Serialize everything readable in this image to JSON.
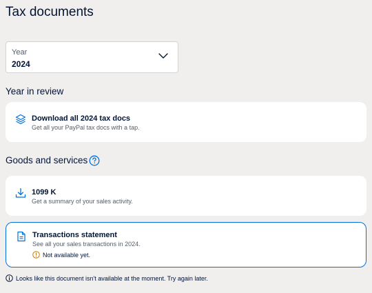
{
  "page": {
    "title": "Tax documents"
  },
  "year_select": {
    "label": "Year",
    "value": "2024"
  },
  "sections": {
    "year_in_review": {
      "heading": "Year in review",
      "card": {
        "title": "Download all 2024 tax docs",
        "subtitle": "Get all your PayPal tax docs with a tap.",
        "icon": "layers-icon"
      }
    },
    "goods_services": {
      "heading": "Goods and services",
      "help_icon": "question-circle-icon",
      "cards": [
        {
          "title": "1099 K",
          "subtitle": "Get a summary of your sales activity.",
          "icon": "download-icon"
        },
        {
          "title": "Transactions statement",
          "subtitle": "See all your sales transactions in 2024.",
          "icon": "document-icon",
          "status": "Not available yet."
        }
      ]
    }
  },
  "footer": {
    "note": "Looks like this document isn't available at the moment. Try again later.",
    "icon": "info-circle-icon"
  },
  "colors": {
    "accent": "#0070e0",
    "warning": "#c77b00",
    "background": "#f1efed",
    "text": "#001435"
  }
}
